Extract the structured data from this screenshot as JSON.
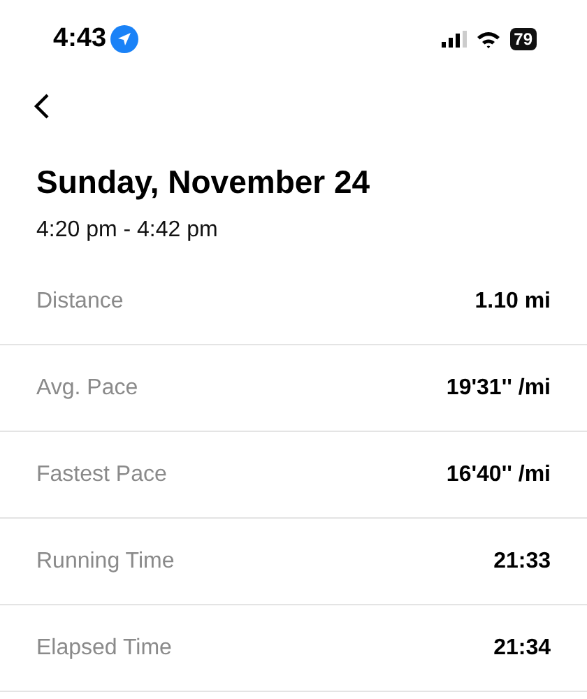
{
  "status_bar": {
    "time": "4:43",
    "battery": "79"
  },
  "title": "Sunday, November 24",
  "subtitle": "4:20 pm - 4:42 pm",
  "stats": [
    {
      "label": "Distance",
      "value": "1.10 mi"
    },
    {
      "label": "Avg. Pace",
      "value": "19'31'' /mi"
    },
    {
      "label": "Fastest Pace",
      "value": "16'40'' /mi"
    },
    {
      "label": "Running Time",
      "value": "21:33"
    },
    {
      "label": "Elapsed Time",
      "value": "21:34"
    }
  ]
}
